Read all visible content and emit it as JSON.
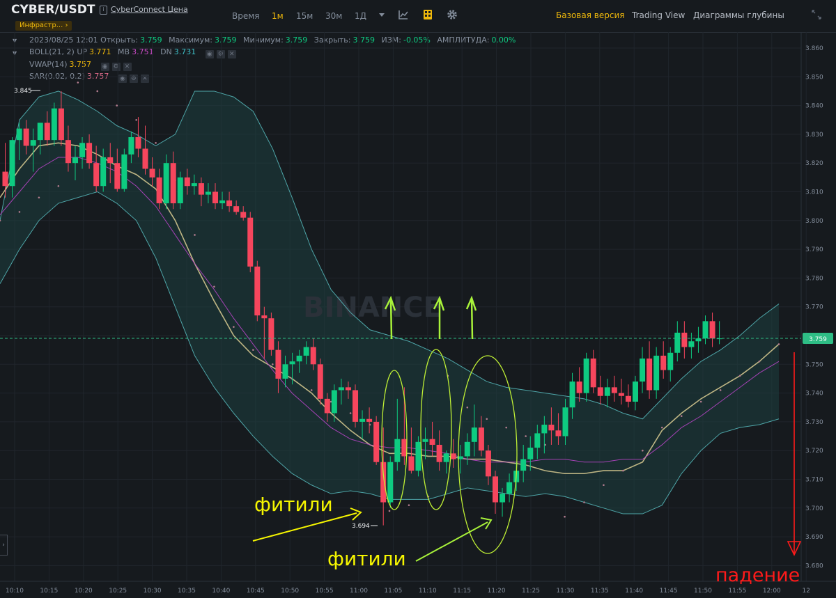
{
  "header": {
    "symbol": "CYBER/USDT",
    "price_link": "CyberConnect Цена",
    "tag": "Инфрастр...",
    "tag_arrow": "›"
  },
  "toolbar": {
    "intervals": [
      "Время",
      "1м",
      "15м",
      "30м",
      "1Д"
    ],
    "active_interval": "1м",
    "views": [
      "Базовая версия",
      "Trading View",
      "Диаграммы глубины"
    ],
    "active_view": "Базовая версия",
    "icons": [
      "dropdown-caret-icon",
      "indicator-chart-icon",
      "layout-grid-icon",
      "settings-gear-icon",
      "fullscreen-icon"
    ]
  },
  "legend": {
    "ohlc": {
      "datetime": "2023/08/25 12:01",
      "open_label": "Открыть:",
      "open": "3.759",
      "high_label": "Максимум:",
      "high": "3.759",
      "low_label": "Минимум:",
      "low": "3.759",
      "close_label": "Закрыть:",
      "close": "3.759",
      "change_label": "ИЗМ:",
      "change": "-0.05%",
      "amp_label": "АМПЛИТУДА:",
      "amp": "0.00%"
    },
    "boll": {
      "label": "BOLL(21, 2)",
      "up_label": "UP",
      "up": "3.771",
      "mb_label": "MB",
      "mb": "3.751",
      "dn_label": "DN",
      "dn": "3.731"
    },
    "vwap": {
      "label": "VWAP(14)",
      "value": "3.757"
    },
    "sar": {
      "label": "SAR(0.02, 0.2)",
      "value": "3.757"
    }
  },
  "annotations": {
    "wicks_1": "фитили",
    "wicks_2": "фитили",
    "fall": "падение",
    "watermark": "BINANCE",
    "high_marker": "3.845",
    "low_marker": "3.694",
    "current_price": "3.759"
  },
  "colors": {
    "up": "#0ecb81",
    "down": "#f6465d",
    "boll_band": "#5cc7c9",
    "vwap": "#e8d89a",
    "mb": "#b545c4",
    "annotation_yellow": "#f5f500",
    "annotation_green": "#a8f23a",
    "annotation_red": "#ff1a1a"
  },
  "chart_data": {
    "type": "candlestick",
    "symbol": "CYBER/USDT",
    "interval": "1m",
    "ylim": [
      3.68,
      3.865
    ],
    "y_ticks": [
      "3.860",
      "3.850",
      "3.840",
      "3.830",
      "3.820",
      "3.810",
      "3.800",
      "3.790",
      "3.780",
      "3.770",
      "3.760",
      "3.750",
      "3.740",
      "3.730",
      "3.720",
      "3.710",
      "3.700",
      "3.690",
      "3.680"
    ],
    "x_ticks": [
      "10:10",
      "10:15",
      "10:20",
      "10:25",
      "10:30",
      "10:35",
      "10:40",
      "10:45",
      "10:50",
      "10:55",
      "11:00",
      "11:05",
      "11:10",
      "11:15",
      "11:20",
      "11:25",
      "11:30",
      "11:35",
      "11:40",
      "11:45",
      "11:50",
      "11:55",
      "12:00",
      "12"
    ],
    "time_start": "10:08",
    "candles": [
      [
        3.817,
        3.827,
        3.808,
        3.812
      ],
      [
        3.812,
        3.829,
        3.808,
        3.828
      ],
      [
        3.828,
        3.834,
        3.821,
        3.832
      ],
      [
        3.832,
        3.835,
        3.823,
        3.826
      ],
      [
        3.826,
        3.832,
        3.817,
        3.828
      ],
      [
        3.828,
        3.834,
        3.823,
        3.834
      ],
      [
        3.834,
        3.838,
        3.826,
        3.828
      ],
      [
        3.828,
        3.841,
        3.826,
        3.839
      ],
      [
        3.839,
        3.845,
        3.826,
        3.828
      ],
      [
        3.828,
        3.833,
        3.817,
        3.82
      ],
      [
        3.82,
        3.826,
        3.814,
        3.822
      ],
      [
        3.822,
        3.829,
        3.818,
        3.827
      ],
      [
        3.827,
        3.83,
        3.818,
        3.82
      ],
      [
        3.82,
        3.826,
        3.81,
        3.812
      ],
      [
        3.812,
        3.825,
        3.81,
        3.822
      ],
      [
        3.822,
        3.827,
        3.813,
        3.82
      ],
      [
        3.82,
        3.825,
        3.81,
        3.811
      ],
      [
        3.811,
        3.825,
        3.81,
        3.823
      ],
      [
        3.823,
        3.831,
        3.82,
        3.829
      ],
      [
        3.829,
        3.836,
        3.822,
        3.825
      ],
      [
        3.825,
        3.833,
        3.816,
        3.818
      ],
      [
        3.818,
        3.822,
        3.812,
        3.815
      ],
      [
        3.815,
        3.818,
        3.804,
        3.806
      ],
      [
        3.806,
        3.823,
        3.804,
        3.82
      ],
      [
        3.82,
        3.824,
        3.804,
        3.806
      ],
      [
        3.806,
        3.817,
        3.804,
        3.815
      ],
      [
        3.815,
        3.818,
        3.809,
        3.812
      ],
      [
        3.812,
        3.816,
        3.809,
        3.813
      ],
      [
        3.813,
        3.815,
        3.805,
        3.809
      ],
      [
        3.809,
        3.813,
        3.806,
        3.81
      ],
      [
        3.81,
        3.813,
        3.804,
        3.806
      ],
      [
        3.806,
        3.81,
        3.804,
        3.807
      ],
      [
        3.807,
        3.81,
        3.803,
        3.805
      ],
      [
        3.805,
        3.807,
        3.802,
        3.803
      ],
      [
        3.803,
        3.805,
        3.8,
        3.801
      ],
      [
        3.801,
        3.803,
        3.782,
        3.784
      ],
      [
        3.784,
        3.786,
        3.765,
        3.767
      ],
      [
        3.767,
        3.77,
        3.752,
        3.766
      ],
      [
        3.766,
        3.768,
        3.753,
        3.755
      ],
      [
        3.755,
        3.758,
        3.74,
        3.745
      ],
      [
        3.745,
        3.753,
        3.742,
        3.75
      ],
      [
        3.75,
        3.754,
        3.743,
        3.751
      ],
      [
        3.751,
        3.755,
        3.747,
        3.753
      ],
      [
        3.753,
        3.758,
        3.75,
        3.756
      ],
      [
        3.756,
        3.759,
        3.748,
        3.75
      ],
      [
        3.75,
        3.752,
        3.736,
        3.738
      ],
      [
        3.738,
        3.74,
        3.73,
        3.733
      ],
      [
        3.733,
        3.743,
        3.73,
        3.741
      ],
      [
        3.741,
        3.745,
        3.736,
        3.742
      ],
      [
        3.742,
        3.744,
        3.738,
        3.741
      ],
      [
        3.741,
        3.743,
        3.728,
        3.73
      ],
      [
        3.73,
        3.734,
        3.724,
        3.731
      ],
      [
        3.731,
        3.735,
        3.726,
        3.73
      ],
      [
        3.73,
        3.732,
        3.715,
        3.716
      ],
      [
        3.716,
        3.728,
        3.694,
        3.702
      ],
      [
        3.702,
        3.718,
        3.7,
        3.716
      ],
      [
        3.716,
        3.738,
        3.713,
        3.724
      ],
      [
        3.724,
        3.742,
        3.715,
        3.718
      ],
      [
        3.718,
        3.728,
        3.712,
        3.713
      ],
      [
        3.713,
        3.725,
        3.711,
        3.723
      ],
      [
        3.723,
        3.728,
        3.717,
        3.724
      ],
      [
        3.724,
        3.73,
        3.718,
        3.722
      ],
      [
        3.722,
        3.727,
        3.713,
        3.716
      ],
      [
        3.716,
        3.72,
        3.712,
        3.719
      ],
      [
        3.719,
        3.724,
        3.714,
        3.717
      ],
      [
        3.717,
        3.722,
        3.712,
        3.718
      ],
      [
        3.718,
        3.726,
        3.715,
        3.723
      ],
      [
        3.723,
        3.736,
        3.718,
        3.728
      ],
      [
        3.728,
        3.732,
        3.718,
        3.72
      ],
      [
        3.72,
        3.722,
        3.708,
        3.711
      ],
      [
        3.711,
        3.713,
        3.698,
        3.702
      ],
      [
        3.702,
        3.707,
        3.697,
        3.705
      ],
      [
        3.705,
        3.712,
        3.702,
        3.709
      ],
      [
        3.709,
        3.716,
        3.706,
        3.713
      ],
      [
        3.713,
        3.722,
        3.709,
        3.717
      ],
      [
        3.717,
        3.725,
        3.713,
        3.721
      ],
      [
        3.721,
        3.729,
        3.717,
        3.726
      ],
      [
        3.726,
        3.732,
        3.719,
        3.729
      ],
      [
        3.729,
        3.735,
        3.722,
        3.727
      ],
      [
        3.727,
        3.733,
        3.722,
        3.725
      ],
      [
        3.725,
        3.738,
        3.722,
        3.735
      ],
      [
        3.735,
        3.747,
        3.731,
        3.744
      ],
      [
        3.744,
        3.749,
        3.737,
        3.74
      ],
      [
        3.74,
        3.754,
        3.737,
        3.752
      ],
      [
        3.752,
        3.755,
        3.74,
        3.742
      ],
      [
        3.742,
        3.746,
        3.736,
        3.739
      ],
      [
        3.739,
        3.745,
        3.735,
        3.742
      ],
      [
        3.742,
        3.746,
        3.737,
        3.74
      ],
      [
        3.74,
        3.745,
        3.736,
        3.739
      ],
      [
        3.739,
        3.743,
        3.735,
        3.737
      ],
      [
        3.737,
        3.746,
        3.734,
        3.744
      ],
      [
        3.744,
        3.756,
        3.74,
        3.752
      ],
      [
        3.752,
        3.758,
        3.738,
        3.741
      ],
      [
        3.741,
        3.756,
        3.738,
        3.753
      ],
      [
        3.753,
        3.758,
        3.745,
        3.748
      ],
      [
        3.748,
        3.756,
        3.744,
        3.754
      ],
      [
        3.754,
        3.765,
        3.751,
        3.761
      ],
      [
        3.761,
        3.765,
        3.752,
        3.756
      ],
      [
        3.756,
        3.761,
        3.752,
        3.758
      ],
      [
        3.758,
        3.763,
        3.754,
        3.759
      ],
      [
        3.759,
        3.767,
        3.757,
        3.765
      ],
      [
        3.765,
        3.768,
        3.756,
        3.759
      ],
      [
        3.759,
        3.765,
        3.757,
        3.759
      ]
    ],
    "series": [
      {
        "name": "BOLL UP",
        "values": [
          3.8,
          3.835,
          3.843,
          3.845,
          3.842,
          3.838,
          3.833,
          3.83,
          3.826,
          3.83,
          3.845,
          3.845,
          3.843,
          3.838,
          3.825,
          3.808,
          3.79,
          3.776,
          3.768,
          3.762,
          3.76,
          3.758,
          3.755,
          3.752,
          3.748,
          3.744,
          3.742,
          3.741,
          3.74,
          3.739,
          3.738,
          3.736,
          3.733,
          3.731,
          3.738,
          3.745,
          3.751,
          3.755,
          3.76,
          3.766,
          3.771
        ]
      },
      {
        "name": "BOLL DN",
        "values": [
          3.778,
          3.79,
          3.8,
          3.806,
          3.808,
          3.81,
          3.806,
          3.8,
          3.787,
          3.77,
          3.753,
          3.742,
          3.733,
          3.725,
          3.718,
          3.712,
          3.708,
          3.705,
          3.706,
          3.705,
          3.703,
          3.703,
          3.703,
          3.705,
          3.707,
          3.706,
          3.705,
          3.704,
          3.705,
          3.704,
          3.702,
          3.7,
          3.698,
          3.698,
          3.701,
          3.712,
          3.72,
          3.726,
          3.728,
          3.729,
          3.731
        ]
      },
      {
        "name": "VWAP",
        "values": [
          3.808,
          3.818,
          3.826,
          3.827,
          3.826,
          3.823,
          3.819,
          3.816,
          3.811,
          3.8,
          3.785,
          3.772,
          3.76,
          3.753,
          3.749,
          3.745,
          3.74,
          3.733,
          3.727,
          3.722,
          3.719,
          3.719,
          3.718,
          3.718,
          3.717,
          3.717,
          3.716,
          3.715,
          3.713,
          3.712,
          3.712,
          3.713,
          3.713,
          3.716,
          3.727,
          3.733,
          3.738,
          3.742,
          3.746,
          3.751,
          3.757
        ]
      },
      {
        "name": "BOLL MB",
        "values": [
          3.802,
          3.81,
          3.818,
          3.822,
          3.822,
          3.82,
          3.817,
          3.812,
          3.805,
          3.795,
          3.785,
          3.776,
          3.766,
          3.757,
          3.748,
          3.74,
          3.734,
          3.728,
          3.724,
          3.722,
          3.721,
          3.721,
          3.72,
          3.719,
          3.717,
          3.716,
          3.716,
          3.716,
          3.717,
          3.717,
          3.716,
          3.716,
          3.717,
          3.717,
          3.722,
          3.728,
          3.732,
          3.737,
          3.742,
          3.747,
          3.751
        ]
      },
      {
        "name": "SAR",
        "values": [
          3.8,
          3.803,
          3.808,
          3.812,
          3.848,
          3.845,
          3.84,
          3.835,
          3.827,
          3.814,
          3.795,
          3.777,
          3.763,
          3.755,
          3.75,
          3.745,
          3.741,
          3.737,
          3.733,
          3.729,
          3.699,
          3.701,
          3.704,
          3.746,
          3.735,
          3.731,
          3.728,
          3.725,
          3.722,
          3.697,
          3.702,
          3.708,
          3.713,
          3.72,
          3.728,
          3.732,
          3.737,
          3.741,
          3.746,
          3.751,
          3.757
        ]
      }
    ]
  }
}
